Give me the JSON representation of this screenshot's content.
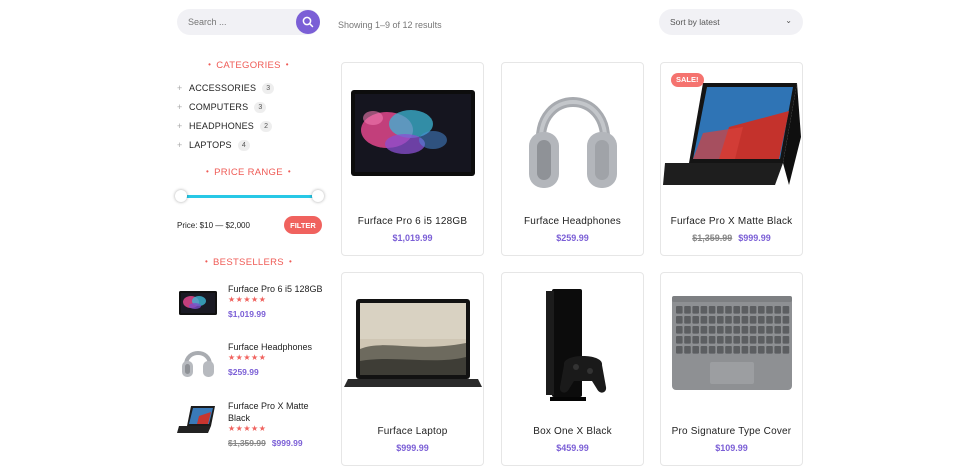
{
  "search": {
    "placeholder": "Search ...",
    "icon": "search-icon"
  },
  "results": {
    "count_text": "Showing 1–9 of 12 results"
  },
  "sort": {
    "selected": "Sort by latest"
  },
  "categories": {
    "title": "CATEGORIES",
    "items": [
      {
        "label": "ACCESSORIES",
        "count": "3"
      },
      {
        "label": "COMPUTERS",
        "count": "3"
      },
      {
        "label": "HEADPHONES",
        "count": "2"
      },
      {
        "label": "LAPTOPS",
        "count": "4"
      }
    ]
  },
  "price_range": {
    "title": "PRICE RANGE",
    "label": "Price: $10 — $2,000",
    "filter_label": "FILTER",
    "min_fraction": 0,
    "max_fraction": 1
  },
  "bestsellers": {
    "title": "BESTSELLERS",
    "items": [
      {
        "name": "Furface Pro 6 i5 128GB",
        "rating": 4.5,
        "price": "$1,019.99",
        "old_price": ""
      },
      {
        "name": "Furface Headphones",
        "rating": 4.5,
        "price": "$259.99",
        "old_price": ""
      },
      {
        "name": "Furface Pro X Matte Black",
        "rating": 4.5,
        "price": "$999.99",
        "old_price": "$1,359.99"
      }
    ]
  },
  "products": [
    {
      "name": "Furface Pro 6 i5 128GB",
      "price": "$1,019.99",
      "old_price": "",
      "badge": ""
    },
    {
      "name": "Furface Headphones",
      "price": "$259.99",
      "old_price": "",
      "badge": ""
    },
    {
      "name": "Furface Pro X Matte Black",
      "price": "$999.99",
      "old_price": "$1,359.99",
      "badge": "SALE!"
    },
    {
      "name": "Furface Laptop",
      "price": "$999.99",
      "old_price": "",
      "badge": ""
    },
    {
      "name": "Box One X Black",
      "price": "$459.99",
      "old_price": "",
      "badge": ""
    },
    {
      "name": "Pro Signature Type Cover",
      "price": "$109.99",
      "old_price": "",
      "badge": ""
    }
  ],
  "colors": {
    "accent": "#7b5fd6",
    "coral": "#f0625e",
    "slider": "#27c8e6"
  }
}
